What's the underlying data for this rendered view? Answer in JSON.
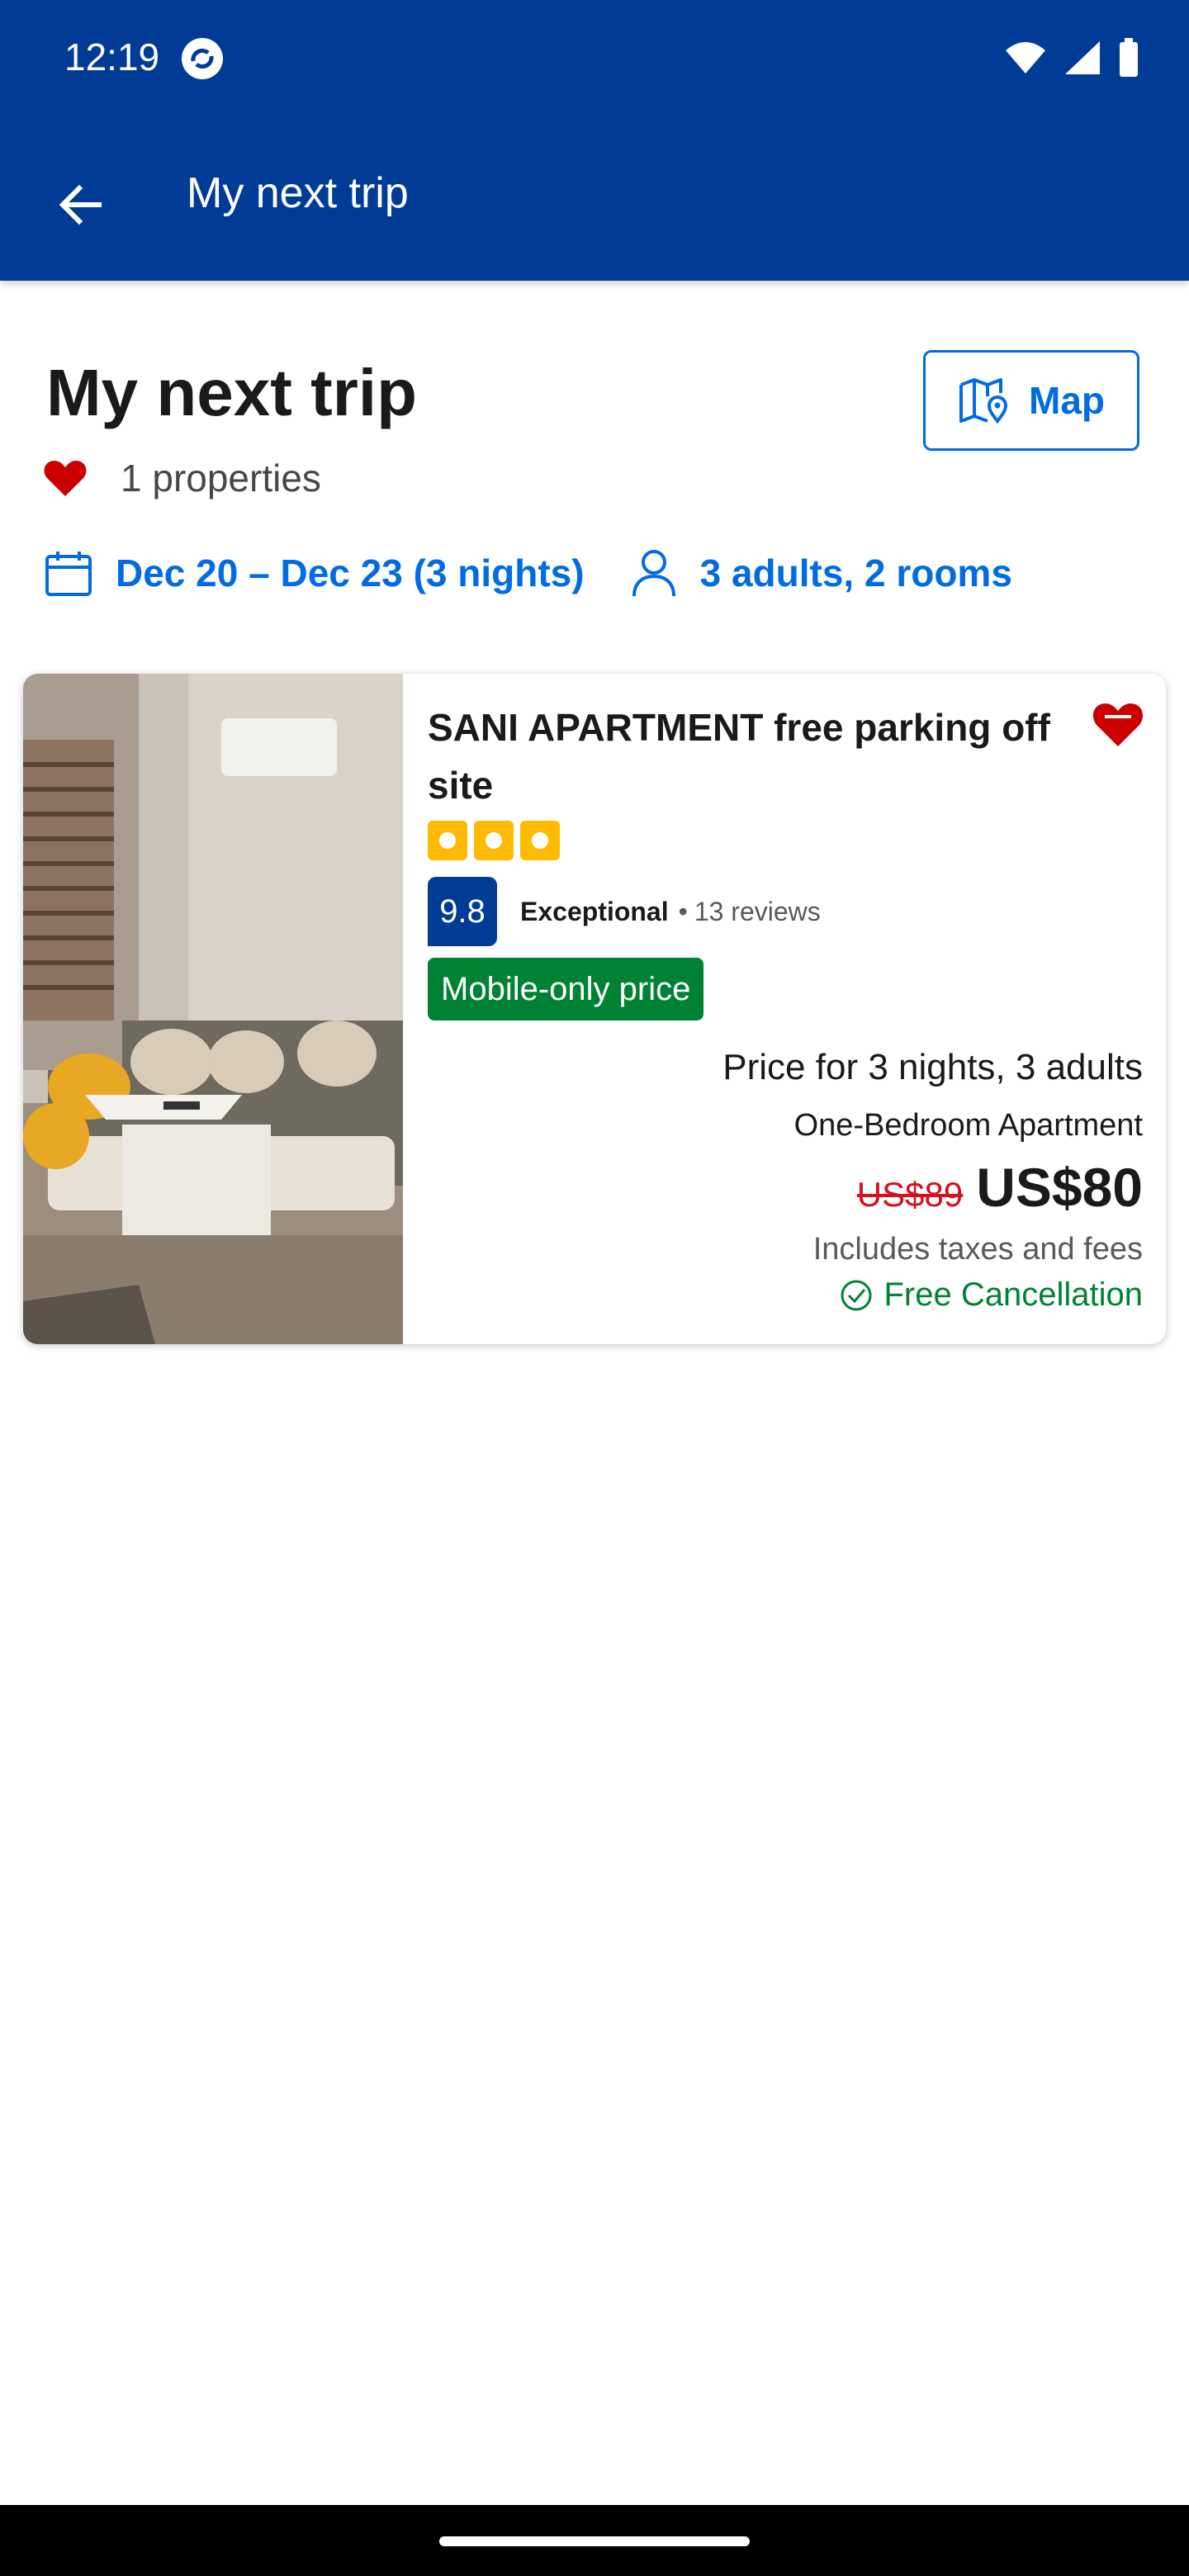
{
  "status_bar": {
    "time": "12:19"
  },
  "app_bar": {
    "title": "My next trip",
    "back_icon": "arrow-left-icon"
  },
  "header": {
    "title": "My next trip",
    "map_button": "Map",
    "properties_count": "1 properties"
  },
  "filters": {
    "dates": "Dec 20 – Dec 23 (3 nights)",
    "guests": "3 adults, 2 rooms"
  },
  "property": {
    "name": "SANI APARTMENT free parking off site",
    "stars": 3,
    "score": "9.8",
    "score_label": "Exceptional",
    "separator": "•",
    "reviews": "13 reviews",
    "deal_badge": "Mobile-only price",
    "price_for": "Price for 3 nights, 3 adults",
    "room_type": "One-Bedroom Apartment",
    "old_price": "US$89",
    "price": "US$80",
    "taxes": "Includes taxes and fees",
    "cancellation": "Free Cancellation",
    "saved": true
  },
  "colors": {
    "brand_blue": "#003b95",
    "action_blue": "#006ce4",
    "deal_green": "#008234",
    "heart_red": "#cc0000",
    "star_yellow": "#febb02"
  }
}
